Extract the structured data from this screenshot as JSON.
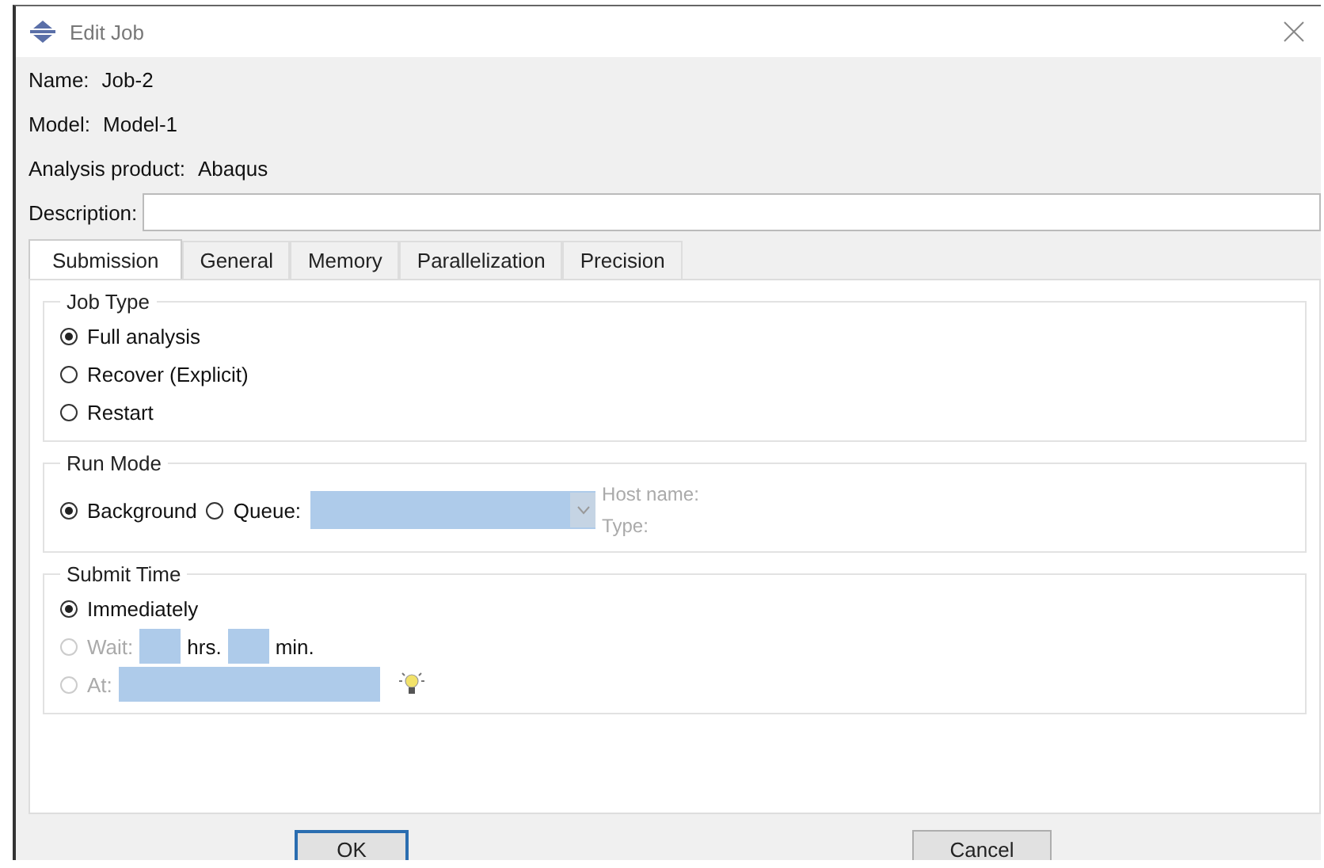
{
  "window": {
    "title": "Edit Job"
  },
  "info": [
    {
      "label": "Name:",
      "value": "Job-2"
    },
    {
      "label": "Model:",
      "value": "Model-1"
    },
    {
      "label": "Analysis product:",
      "value": "Abaqus"
    }
  ],
  "description": {
    "label": "Description:"
  },
  "tabs": [
    {
      "label": "Submission",
      "selected": true
    },
    {
      "label": "General",
      "selected": false
    },
    {
      "label": "Memory",
      "selected": false
    },
    {
      "label": "Parallelization",
      "selected": false
    },
    {
      "label": "Precision",
      "selected": false
    }
  ],
  "job_type": {
    "title": "Job Type",
    "options": [
      {
        "label": "Full analysis",
        "selected": true
      },
      {
        "label": "Recover (Explicit)",
        "selected": false
      },
      {
        "label": "Restart",
        "selected": false
      }
    ]
  },
  "run_mode": {
    "title": "Run Mode",
    "options": [
      {
        "label": "Background",
        "selected": true
      },
      {
        "label": "Queue:",
        "selected": false
      }
    ],
    "host_name_label": "Host name:",
    "type_label": "Type:"
  },
  "submit_time": {
    "title": "Submit Time",
    "options": [
      {
        "kind": "plain",
        "label": "Immediately",
        "selected": true,
        "disabled": false
      },
      {
        "kind": "wait",
        "label": "Wait:",
        "selected": false,
        "disabled": true,
        "hours_label": "hrs.",
        "minutes_label": "min."
      },
      {
        "kind": "at",
        "label": "At:",
        "selected": false,
        "disabled": true
      }
    ]
  },
  "buttons": [
    {
      "label": "OK",
      "focused": true
    },
    {
      "label": "Cancel",
      "focused": false
    }
  ]
}
